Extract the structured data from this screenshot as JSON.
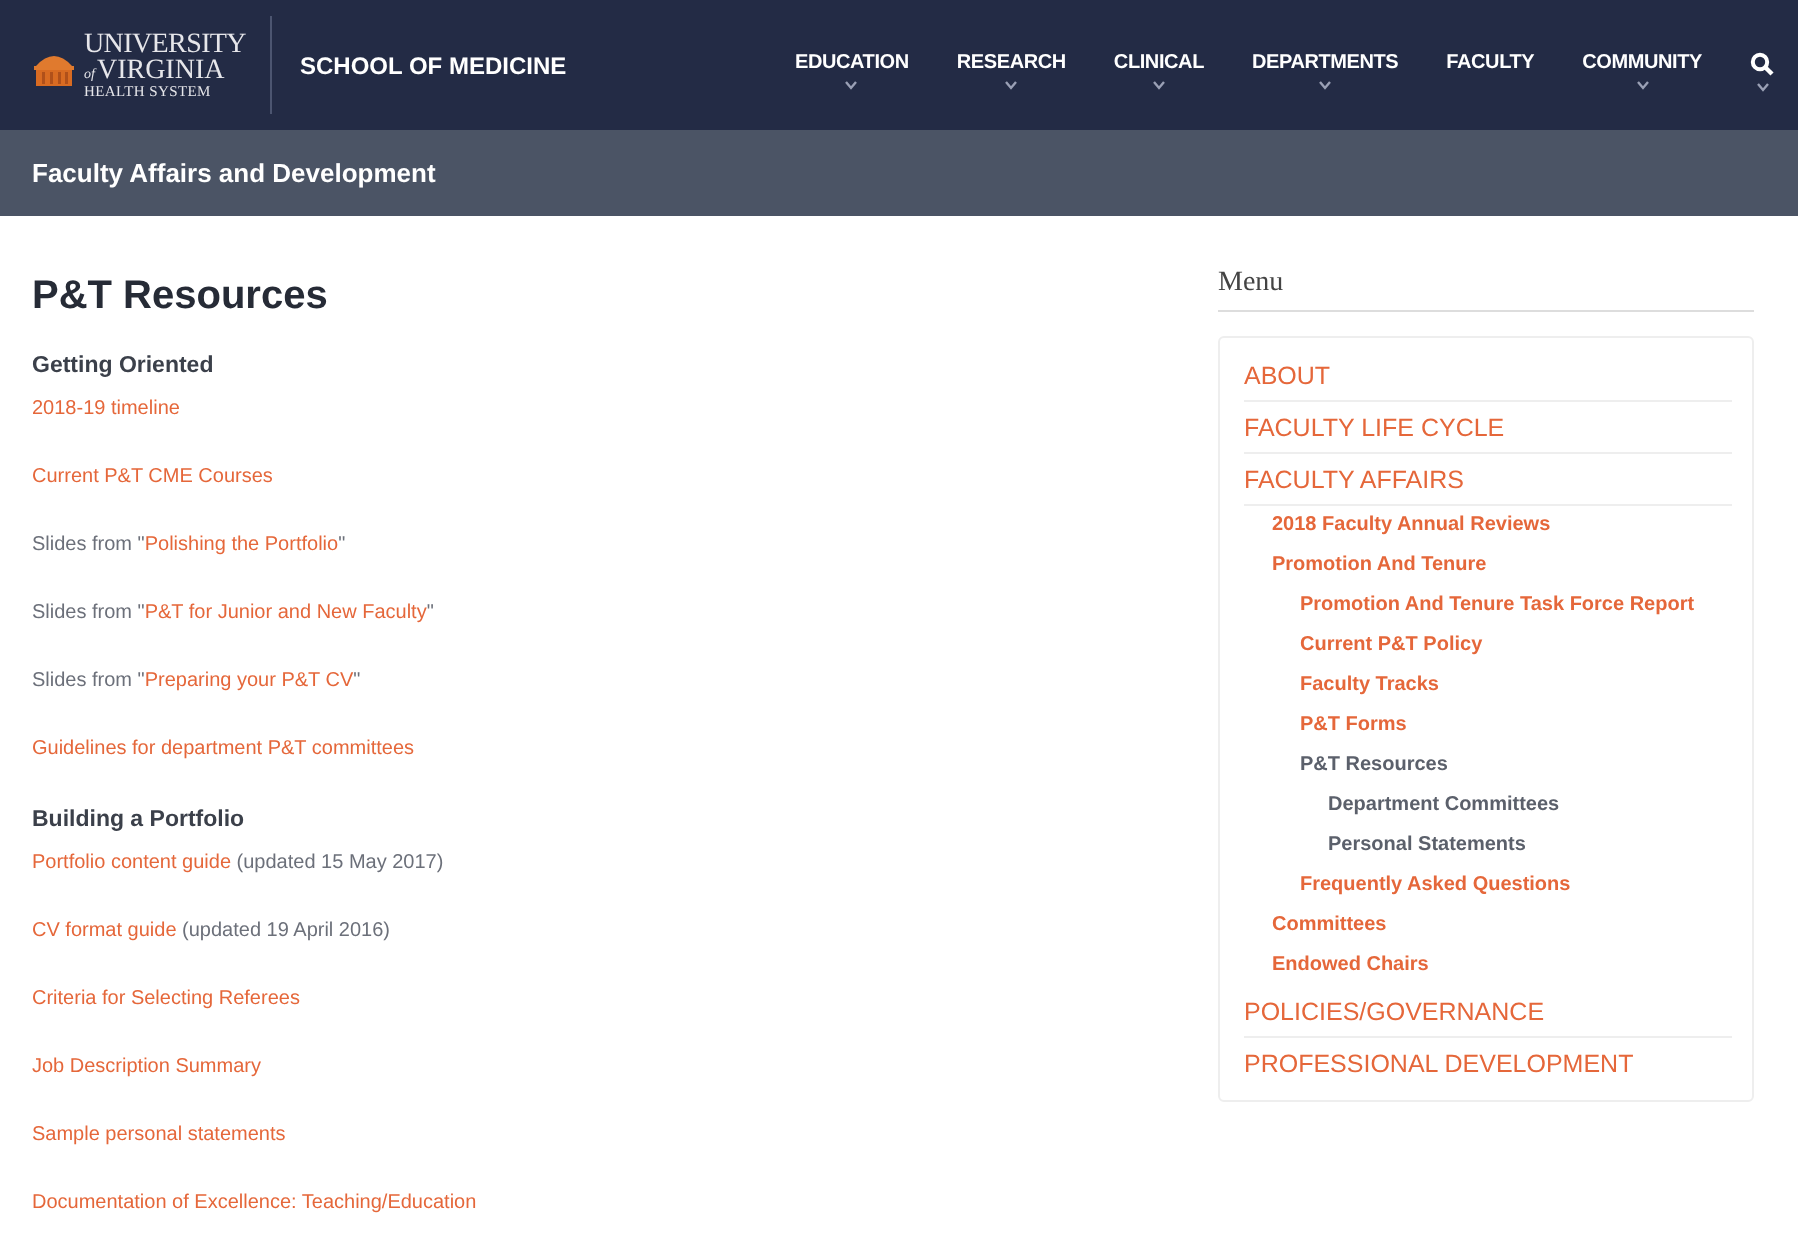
{
  "header": {
    "logo": {
      "line_1": "UNIVERSITY",
      "of": "of",
      "line_2": "VIRGINIA",
      "line_3": "HEALTH SYSTEM"
    },
    "school": "SCHOOL OF MEDICINE",
    "nav": [
      {
        "label": "EDUCATION",
        "dropdown": true
      },
      {
        "label": "RESEARCH",
        "dropdown": true
      },
      {
        "label": "CLINICAL",
        "dropdown": true
      },
      {
        "label": "DEPARTMENTS",
        "dropdown": true
      },
      {
        "label": "FACULTY",
        "dropdown": false
      },
      {
        "label": "COMMUNITY",
        "dropdown": true
      }
    ],
    "search_dropdown": true
  },
  "section_bar": {
    "title": "Faculty Affairs and Development"
  },
  "content": {
    "title": "P&T Resources",
    "items": [
      {
        "kind": "heading",
        "text": "Getting Oriented"
      },
      {
        "kind": "link",
        "link": "2018-19 timeline"
      },
      {
        "kind": "link",
        "link": "Current P&T CME Courses"
      },
      {
        "kind": "link",
        "before": "Slides from \"",
        "link": "Polishing the Portfolio",
        "after": "\""
      },
      {
        "kind": "link",
        "before": "Slides from \"",
        "link": "P&T for Junior and New Faculty",
        "after": "\""
      },
      {
        "kind": "link",
        "before": "Slides from \"",
        "link": "Preparing your P&T CV",
        "after": "\""
      },
      {
        "kind": "link",
        "link": "Guidelines for department P&T committees"
      },
      {
        "kind": "heading",
        "text": "Building a Portfolio"
      },
      {
        "kind": "link",
        "link": "Portfolio content guide",
        "after": " (updated 15 May 2017)"
      },
      {
        "kind": "link",
        "link": "CV format guide",
        "after": " (updated 19 April 2016)"
      },
      {
        "kind": "link",
        "link": "Criteria for Selecting Referees"
      },
      {
        "kind": "link",
        "link": "Job Description Summary"
      },
      {
        "kind": "link",
        "link": "Sample personal statements"
      },
      {
        "kind": "link",
        "link": "Documentation of Excellence: Teaching/Education"
      }
    ]
  },
  "menu": {
    "title": "Menu",
    "items": [
      {
        "label": "ABOUT",
        "selected": false
      },
      {
        "label": "FACULTY LIFE CYCLE",
        "selected": false
      },
      {
        "label": "FACULTY AFFAIRS",
        "selected": false,
        "children": [
          {
            "label": "2018 Faculty Annual Reviews",
            "selected": false
          },
          {
            "label": "Promotion And Tenure",
            "selected": false,
            "children": [
              {
                "label": "Promotion And Tenure Task Force Report",
                "selected": false
              },
              {
                "label": "Current P&T Policy",
                "selected": false
              },
              {
                "label": "Faculty Tracks",
                "selected": false
              },
              {
                "label": "P&T Forms",
                "selected": false
              },
              {
                "label": "P&T Resources",
                "selected": true,
                "children": [
                  {
                    "label": "Department Committees",
                    "selected": true
                  },
                  {
                    "label": "Personal Statements",
                    "selected": true
                  }
                ]
              },
              {
                "label": "Frequently Asked Questions",
                "selected": false
              }
            ]
          },
          {
            "label": "Committees",
            "selected": false
          },
          {
            "label": "Endowed Chairs",
            "selected": false
          }
        ]
      },
      {
        "label": "POLICIES/GOVERNANCE",
        "selected": false
      },
      {
        "label": "PROFESSIONAL DEVELOPMENT",
        "selected": false
      }
    ]
  }
}
